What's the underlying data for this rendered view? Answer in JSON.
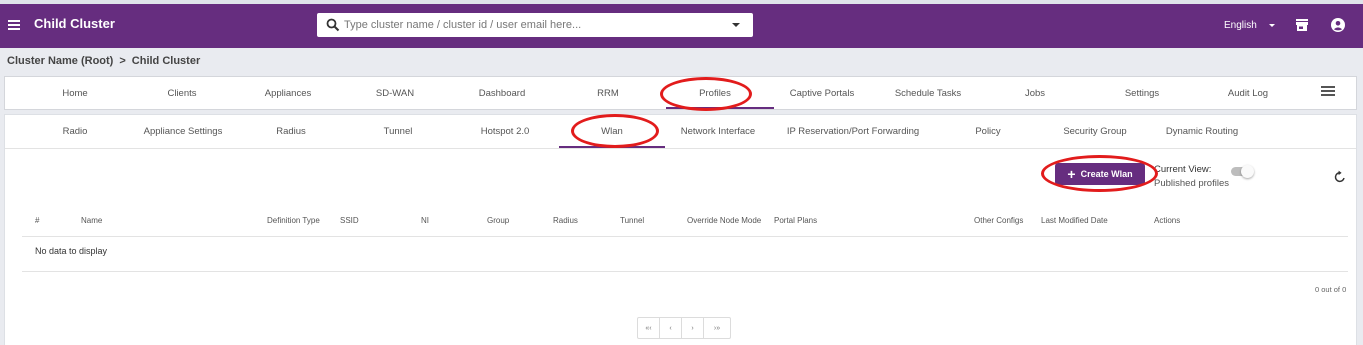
{
  "header": {
    "app_title": "Child Cluster",
    "search_placeholder": "Type cluster name / cluster id / user email here...",
    "language": "English"
  },
  "breadcrumb": [
    "Cluster Name (Root)",
    "Child Cluster"
  ],
  "breadcrumb_separator": ">",
  "main_nav": {
    "items": [
      "Home",
      "Clients",
      "Appliances",
      "SD-WAN",
      "Dashboard",
      "RRM",
      "Profiles",
      "Captive Portals",
      "Schedule Tasks",
      "Jobs",
      "Settings",
      "Audit Log"
    ],
    "active": "Profiles"
  },
  "sub_nav": {
    "items": [
      "Radio",
      "Appliance Settings",
      "Radius",
      "Tunnel",
      "Hotspot 2.0",
      "Wlan",
      "Network Interface",
      "IP Reservation/Port Forwarding",
      "Policy",
      "Security Group",
      "Dynamic Routing"
    ],
    "active": "Wlan"
  },
  "toolbar": {
    "create_label": "Create Wlan",
    "current_view_label": "Current View:",
    "current_view_value": "Published profiles"
  },
  "table": {
    "columns": [
      "#",
      "Name",
      "Definition Type",
      "SSID",
      "NI",
      "Group",
      "Radius",
      "Tunnel",
      "Override Node Mode",
      "Portal Plans",
      "Other Configs",
      "Last Modified Date",
      "Actions"
    ],
    "empty_text": "No data to display",
    "count_text": "0 out of 0"
  },
  "pagination": [
    "«‹",
    "‹",
    "›",
    "›»"
  ],
  "colors": {
    "brand": "#662d7f",
    "annotation": "#e21c1c"
  }
}
